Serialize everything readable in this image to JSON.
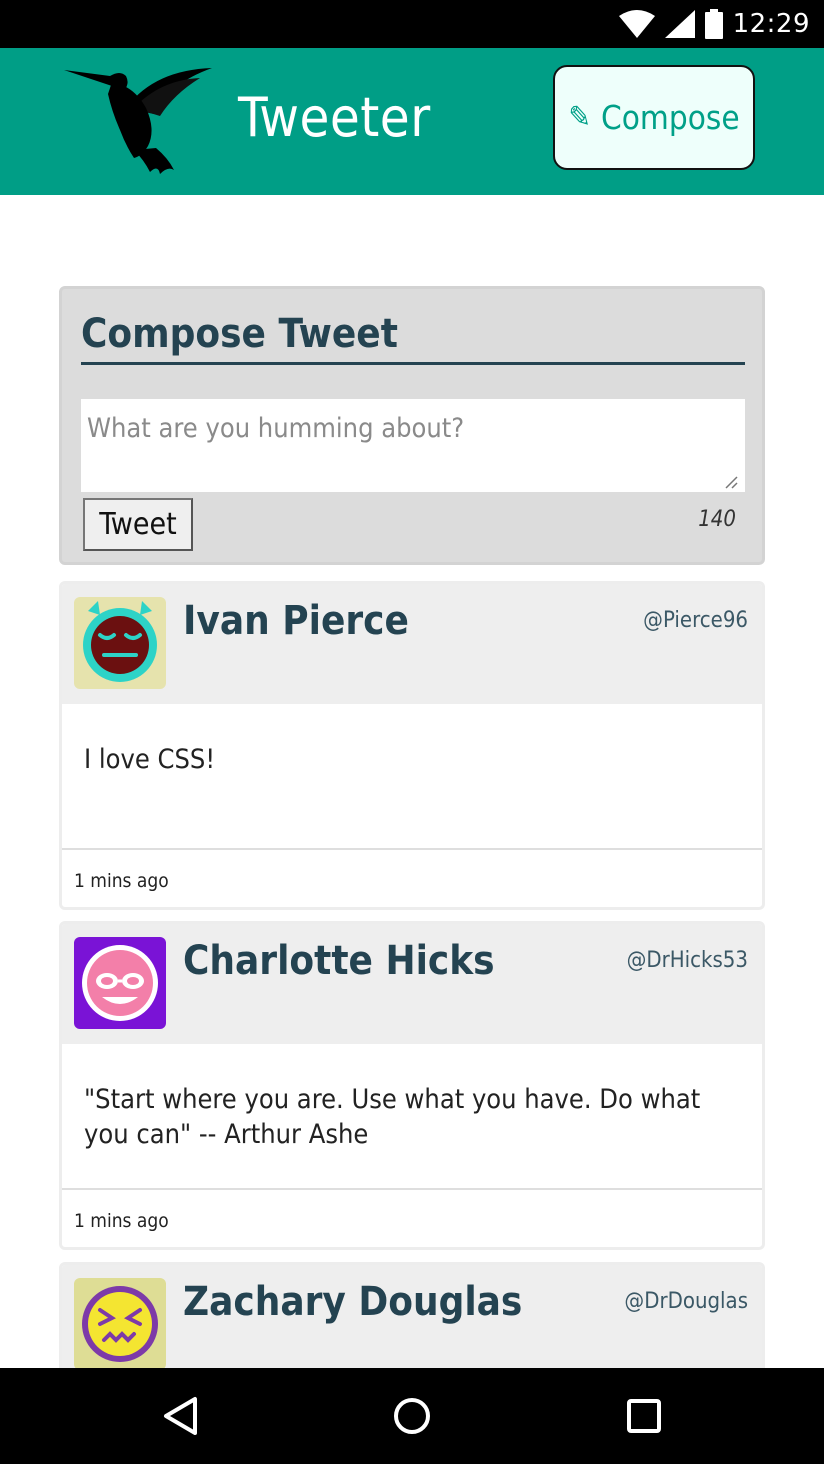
{
  "status_bar": {
    "time": "12:29",
    "icons": [
      "wifi-icon",
      "cell-signal-icon",
      "battery-icon"
    ]
  },
  "header": {
    "logo": "hummingbird-logo",
    "title": "Tweeter",
    "compose_button": {
      "icon": "pencil-icon",
      "label": "✎",
      "text": "Compose"
    }
  },
  "compose": {
    "heading": "Compose Tweet",
    "placeholder": "What are you humming about?",
    "value": "",
    "submit_label": "Tweet",
    "counter": "140"
  },
  "tweets": [
    {
      "name": "Ivan Pierce",
      "handle": "@Pierce96",
      "text": "I love CSS!",
      "timestamp": "1 mins ago",
      "avatar": {
        "icon": "sleepy-face-icon",
        "bg": "#e6e3ad",
        "accent": "#2dd3c7",
        "face": "#6b1010"
      }
    },
    {
      "name": "Charlotte Hicks",
      "handle": "@DrHicks53",
      "text": "\"Start where you are. Use what you have. Do what you can\" -- Arthur Ashe",
      "timestamp": "1 mins ago",
      "avatar": {
        "icon": "nerd-face-icon",
        "bg": "#7a13d6",
        "accent": "#ffffff",
        "face": "#f37fa9"
      }
    },
    {
      "name": "Zachary Douglas",
      "handle": "@DrDouglas",
      "text": "",
      "timestamp": "",
      "avatar": {
        "icon": "squint-face-icon",
        "bg": "#dedd95",
        "accent": "#7d3aa8",
        "face": "#f4e531"
      }
    }
  ],
  "navigation": {
    "buttons": [
      "back-icon",
      "home-icon",
      "recents-icon"
    ]
  },
  "colors": {
    "brand": "#009e86",
    "heading": "#244351",
    "compose_button_bg": "#eefffb",
    "compose_button_text": "#00a088"
  }
}
